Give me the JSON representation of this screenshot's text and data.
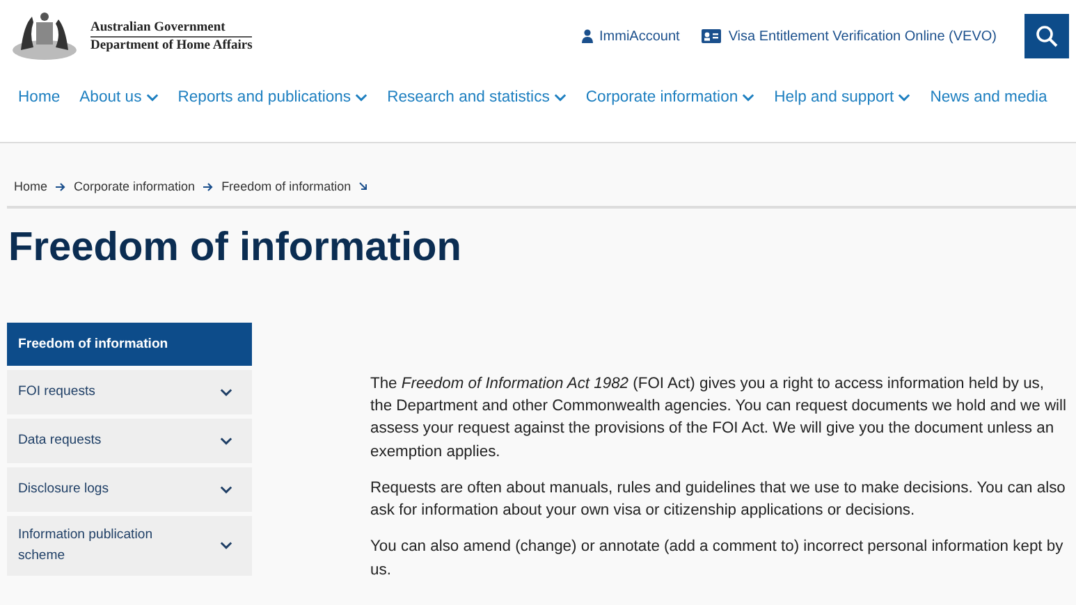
{
  "header": {
    "logo_lines": [
      "Australian Government",
      "Department of Home Affairs"
    ],
    "utility_links": [
      {
        "kind": "person",
        "label": "ImmiAccount"
      },
      {
        "kind": "card",
        "label": "Visa Entitlement Verification Online (VEVO)"
      }
    ]
  },
  "nav": [
    {
      "label": "Home",
      "dropdown": false
    },
    {
      "label": "About us",
      "dropdown": true
    },
    {
      "label": "Reports and publications",
      "dropdown": true
    },
    {
      "label": "Research and statistics",
      "dropdown": true
    },
    {
      "label": "Corporate information",
      "dropdown": true
    },
    {
      "label": "Help and support",
      "dropdown": true
    },
    {
      "label": "News and media",
      "dropdown": false
    }
  ],
  "breadcrumbs": [
    "Home",
    "Corporate information",
    "Freedom of information"
  ],
  "page_title": "Freedom of information",
  "sidebar": [
    {
      "label": "Freedom of information",
      "selected": true,
      "expandable": false
    },
    {
      "label": "FOI requests",
      "selected": false,
      "expandable": true
    },
    {
      "label": "Data requests",
      "selected": false,
      "expandable": true
    },
    {
      "label": "Disclosure logs",
      "selected": false,
      "expandable": true
    },
    {
      "label": "Information publication scheme",
      "selected": false,
      "expandable": true
    }
  ],
  "paragraphs": [
    "The *Freedom of Information Act 1982* (FOI Act) gives you a right to access information held by us, the Department and other Commonwealth agencies. You can request documents we hold and we will assess your request against the provisions of the FOI Act. We will give you the document unless an exemption applies.",
    "Requests are often about manuals, rules and guidelines that we use to make decisions. You can also ask for information about your own visa or citizenship applications or decisions.",
    "You can also amend (change) or annotate (add a comment to) incorrect personal information kept by us."
  ]
}
